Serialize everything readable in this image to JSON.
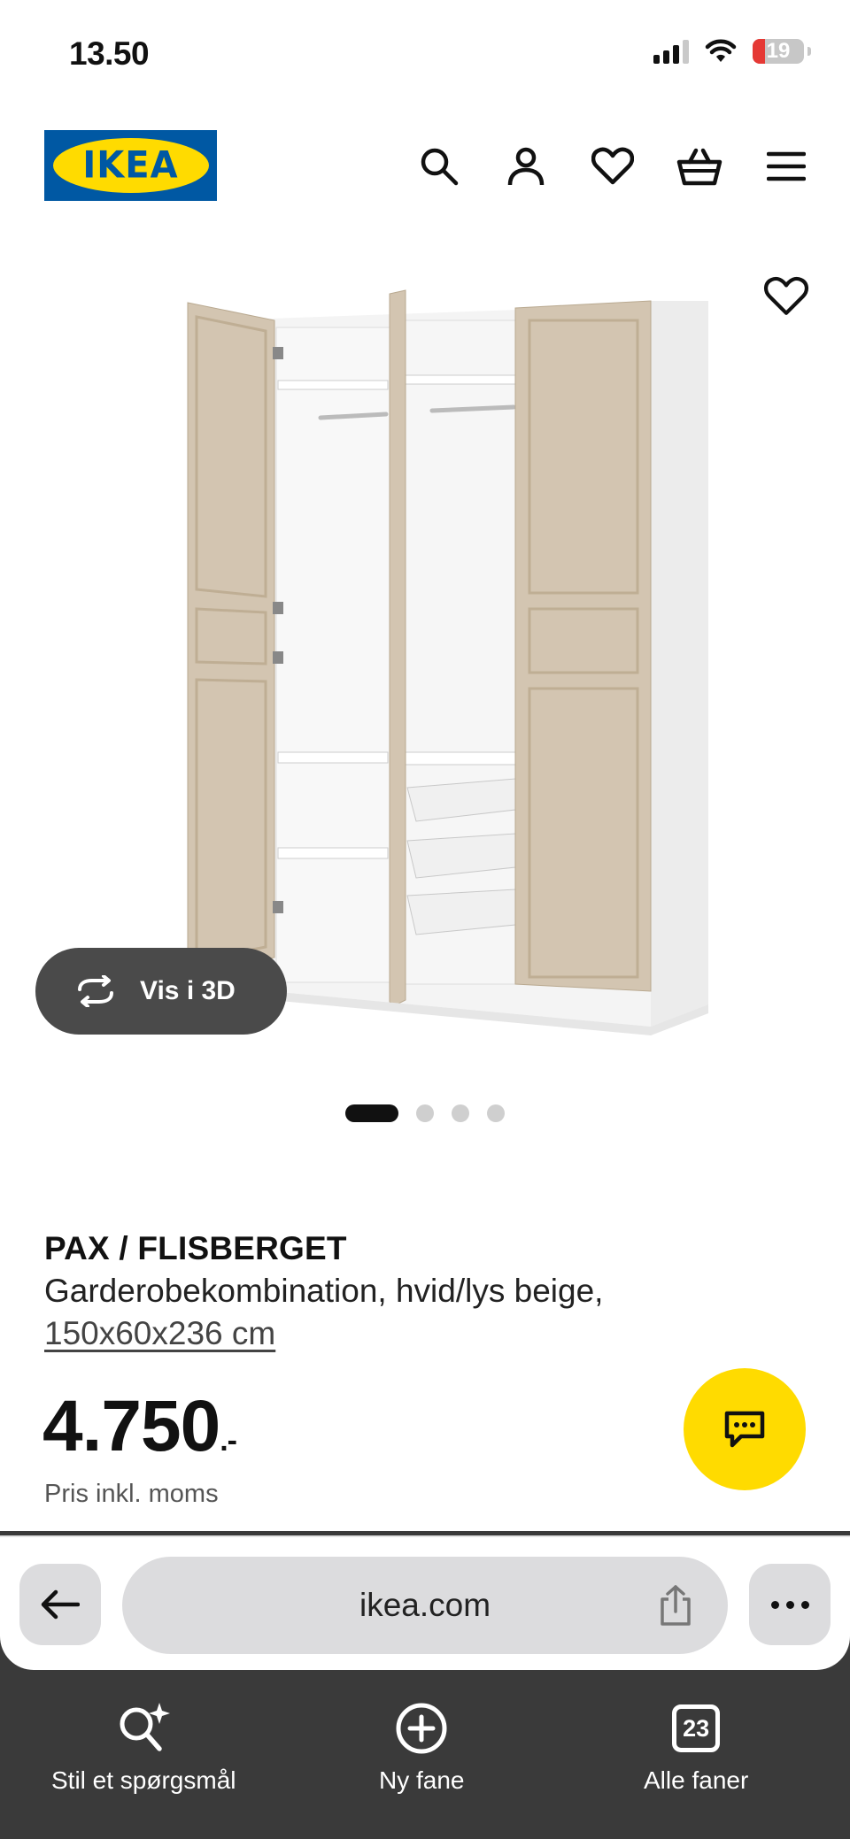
{
  "status_bar": {
    "time": "13.50",
    "battery": "19"
  },
  "header": {
    "logo_text": "IKEA",
    "icons": [
      "search-icon",
      "account-icon",
      "heart-icon",
      "basket-icon",
      "menu-icon"
    ]
  },
  "gallery": {
    "view_3d_label": "Vis i 3D",
    "total_images": 4,
    "active_index": 0
  },
  "product": {
    "title": "PAX / FLISBERGET",
    "description": "Garderobekombination, hvid/lys beige,",
    "size": "150x60x236 cm",
    "price": "4.750",
    "price_suffix": ".-",
    "price_note": "Pris inkl. moms"
  },
  "browser": {
    "url": "ikea.com"
  },
  "toolbar": {
    "ask_label": "Stil et spørgsmål",
    "new_tab_label": "Ny fane",
    "tab_count": "23",
    "all_tabs_label": "Alle faner"
  },
  "colors": {
    "ikea_blue": "#0058a3",
    "ikea_yellow": "#ffdb00",
    "door_beige": "#d3c5b1"
  }
}
